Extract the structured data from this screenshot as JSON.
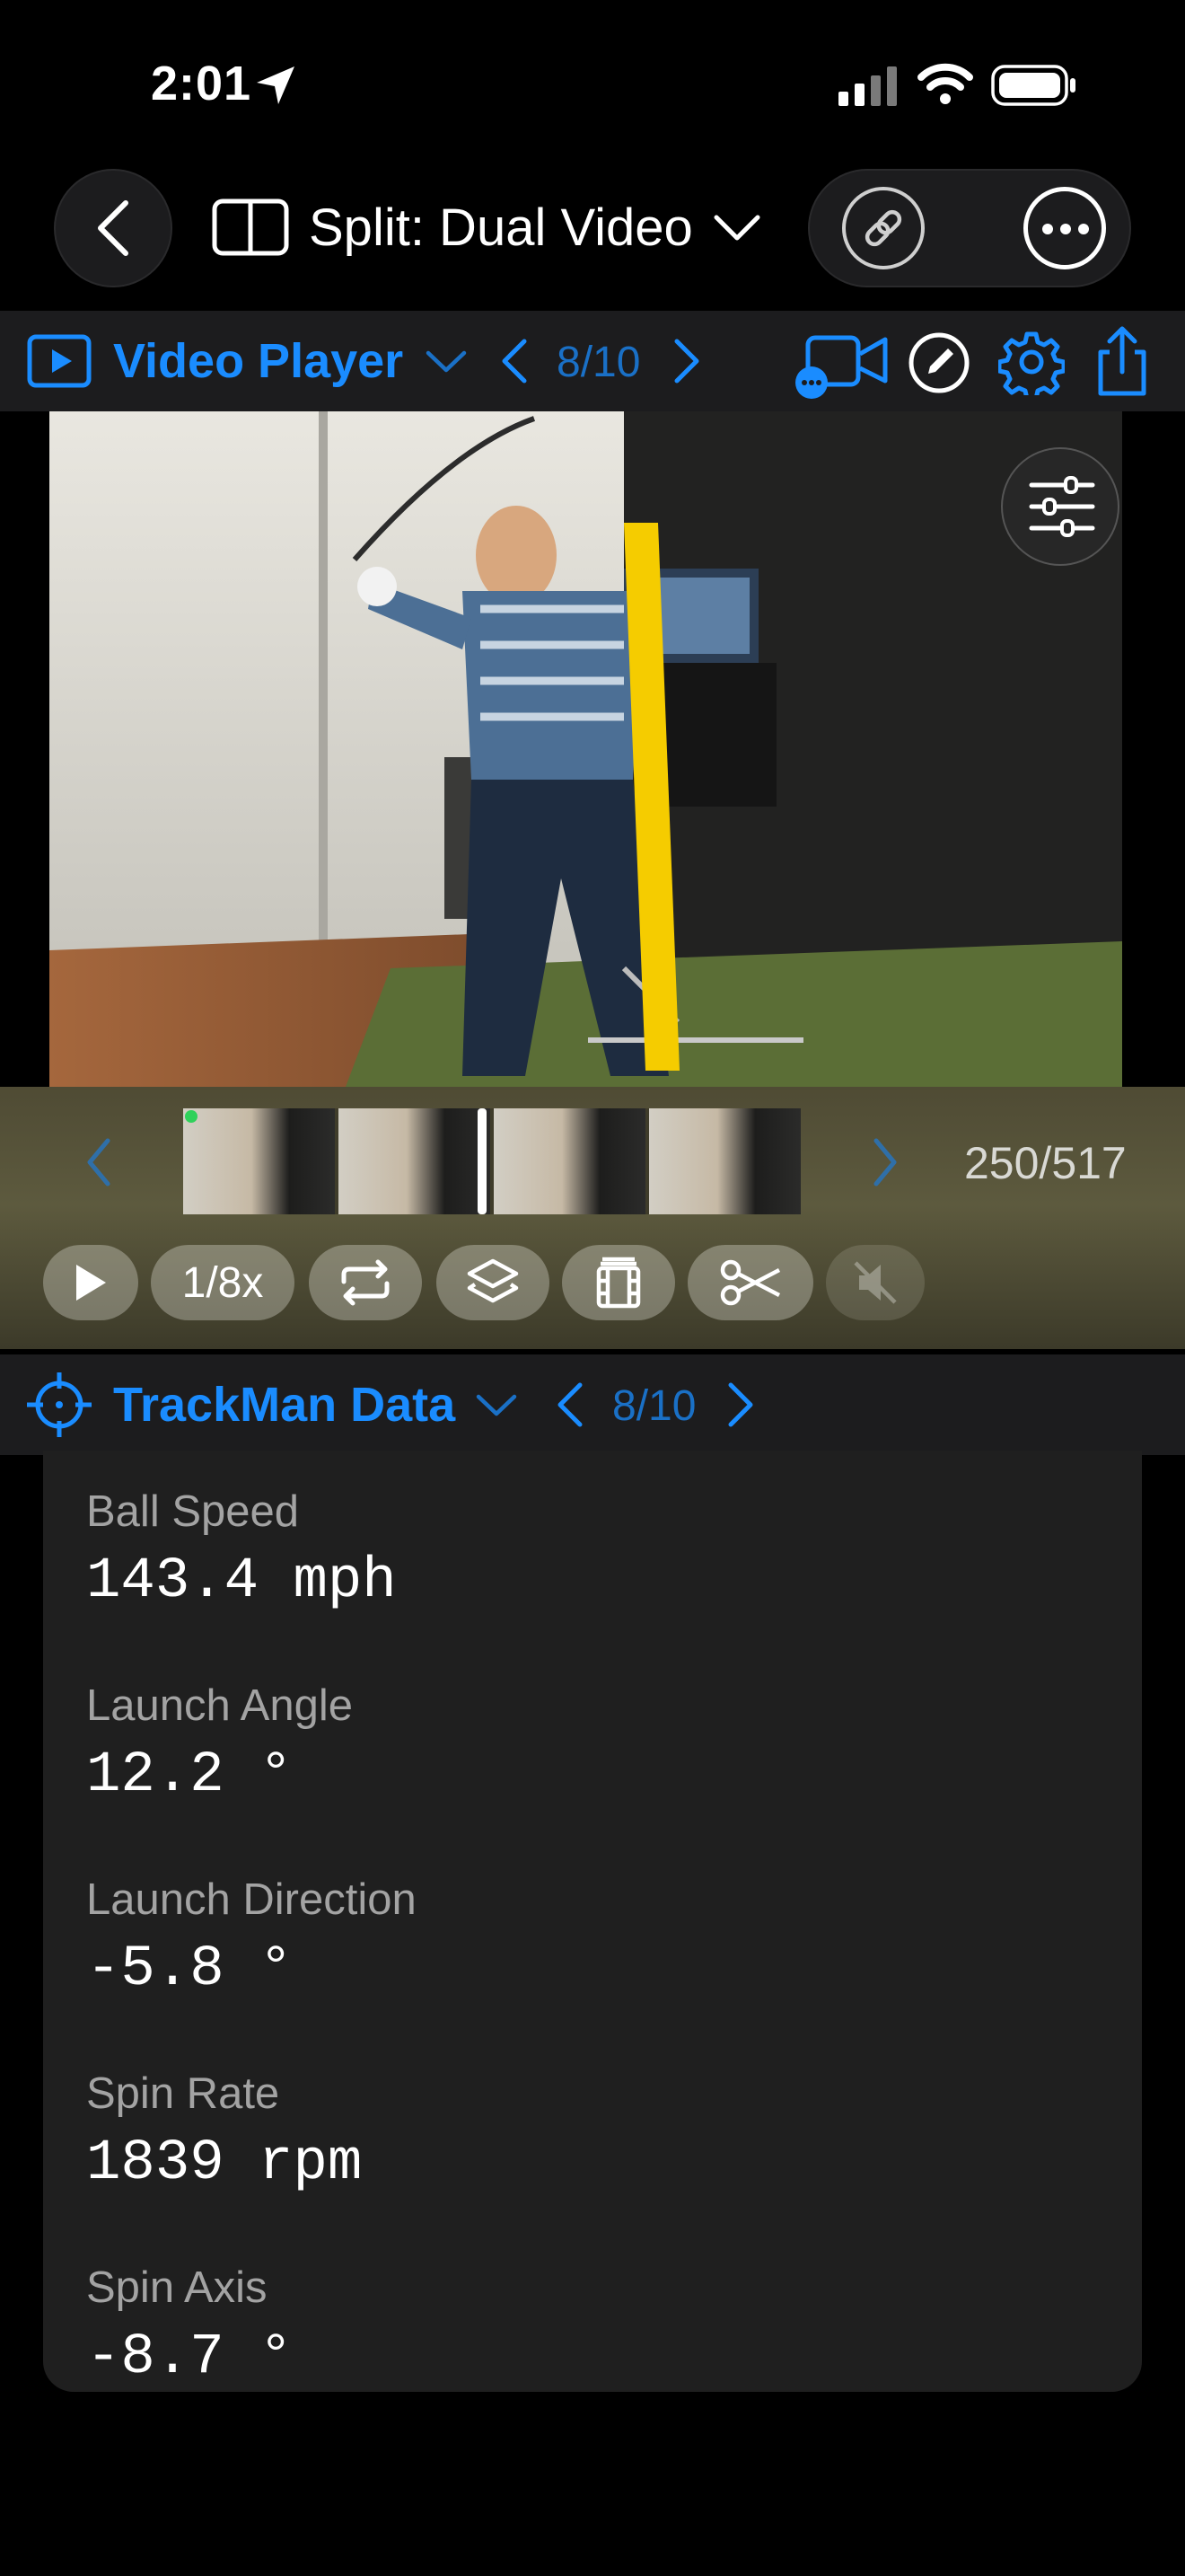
{
  "status": {
    "time": "2:01"
  },
  "nav": {
    "title": "Split: Dual Video"
  },
  "video_player": {
    "title": "Video Player",
    "count": "8/10",
    "frame_counter": "250/517",
    "speed_label": "1/8x"
  },
  "trackman": {
    "title": "TrackMan Data",
    "count": "8/10",
    "metrics": [
      {
        "label": "Ball Speed",
        "value": "143.4 mph"
      },
      {
        "label": "Launch Angle",
        "value": "12.2 °"
      },
      {
        "label": "Launch Direction",
        "value": "-5.8 °"
      },
      {
        "label": "Spin Rate",
        "value": "1839 rpm"
      },
      {
        "label": "Spin Axis",
        "value": "-8.7 °"
      }
    ]
  },
  "colors": {
    "accent": "#1a8cff",
    "alignment_line": "#f5cc00",
    "background": "#000000",
    "panel": "#1c1c1e"
  }
}
